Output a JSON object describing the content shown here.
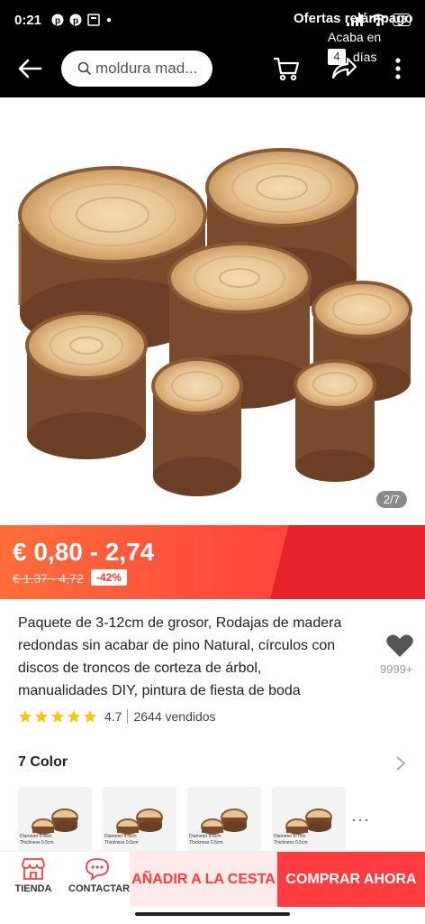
{
  "status": {
    "time": "0:21",
    "battery": "13"
  },
  "nav": {
    "search_text": "moldura mad..."
  },
  "gallery": {
    "pager": "2/7"
  },
  "price": {
    "range": "€ 0,80 - 2,74",
    "old_range": "€ 1,37 - 4,72",
    "discount": "-42%"
  },
  "flash": {
    "title": "Ofertas relámpago",
    "ends_label": "Acaba en",
    "days_number": "4",
    "days_label": "días"
  },
  "product": {
    "title": "Paquete de 3-12cm de grosor, Rodajas de madera redondas sin acabar de pino Natural, círculos con discos de troncos de corteza de árbol, manualidades DIY, pintura de fiesta de boda",
    "wish_count": "9999+",
    "rating": "4.7",
    "rating_stars": 5,
    "sold": "2644 vendidos"
  },
  "colors": {
    "heading": "7 Color",
    "thumbs": [
      {
        "label": "Diameter 3-4cm\nThickness 0.5cm"
      },
      {
        "label": "Diameter 4-5cm\nThickness 0.5cm"
      },
      {
        "label": "Diameter 5-6cm\nThickness 0.5cm"
      },
      {
        "label": "Diameter 6-7cm\nThickness 0.5cm"
      }
    ],
    "more": "···"
  },
  "bottom": {
    "store_label": "TIENDA",
    "contact_label": "CONTACTAR",
    "add_to_cart": "AÑADIR A LA CESTA",
    "buy_now": "COMPRAR AHORA"
  },
  "theme": {
    "accent": "#ff3c40",
    "star": "#ffc400"
  }
}
